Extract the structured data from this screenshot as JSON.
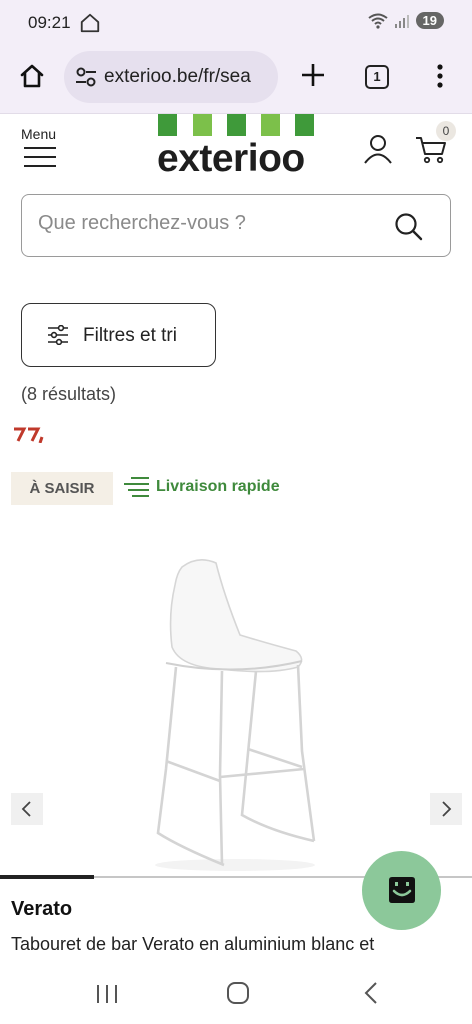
{
  "status_bar": {
    "time": "09:21",
    "battery": "19",
    "icons": [
      "home-outline-icon",
      "wifi-icon",
      "signal-icon",
      "battery-icon"
    ]
  },
  "browser": {
    "url": "exterioo.be/fr/sea",
    "tab_count": "1",
    "icons": [
      "home-icon",
      "site-settings-icon",
      "new-tab-plus-icon",
      "tabs-icon",
      "more-menu-icon"
    ]
  },
  "header": {
    "menu_label": "Menu",
    "logo_text": "exterioo",
    "cart_count": "0",
    "brand_colors": {
      "green_dark": "#3f9a3a",
      "green_light": "#7cc04a"
    }
  },
  "search": {
    "placeholder": "Que recherchez-vous ?"
  },
  "filters": {
    "button_label": "Filtres et tri",
    "results_text": "(8 résultats)"
  },
  "product": {
    "badge": "À SAISIR",
    "delivery_label": "Livraison rapide",
    "name": "Verato",
    "description": "Tabouret de bar Verato en aluminium blanc et",
    "carousel_progress": 0.2
  },
  "colors": {
    "delivery_green": "#3f8a3c",
    "chat_fab": "#8cc89a",
    "price_red": "#c0392b"
  }
}
